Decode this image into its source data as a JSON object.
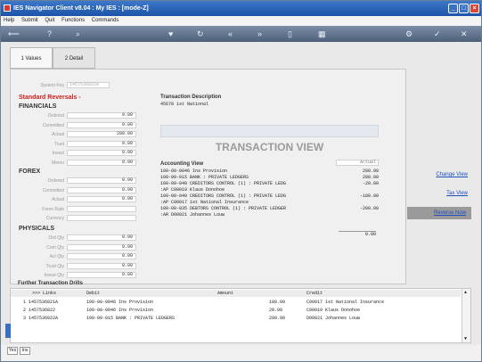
{
  "window": {
    "title": "IES Navigator Client v8.04 : My IES :     [mode-Z]"
  },
  "menu": [
    "Help",
    "Submit",
    "Quit",
    "Functions",
    "Commands"
  ],
  "tabs": [
    {
      "label": "1 Values"
    },
    {
      "label": "2 Detail"
    }
  ],
  "system_key": {
    "label": "System Key",
    "value": "1457536822A"
  },
  "standard_reversals": "Standard Reversals -",
  "financials": {
    "heading": "FINANCIALS",
    "rows": [
      {
        "label": "Ordered",
        "value": "0.00"
      },
      {
        "label": "Committed",
        "value": "0.00"
      },
      {
        "label": "Actual",
        "value": "200.00"
      },
      {
        "label": "Trust",
        "value": "0.00"
      },
      {
        "label": "Invest",
        "value": "0.00"
      },
      {
        "label": "Memo",
        "value": "0.00"
      }
    ]
  },
  "forex": {
    "heading": "FOREX",
    "rows": [
      {
        "label": "Ordered",
        "value": "0.00"
      },
      {
        "label": "Committed",
        "value": "0.00"
      },
      {
        "label": "Actual",
        "value": "0.00"
      },
      {
        "label": "Forex Rate",
        "value": ""
      },
      {
        "label": "Currency",
        "value": ""
      }
    ]
  },
  "physicals": {
    "heading": "PHYSICALS",
    "rows": [
      {
        "label": "Ord Qty",
        "value": "0.00"
      },
      {
        "label": "Com Qty",
        "value": "0.00"
      },
      {
        "label": "Act Qty",
        "value": "0.00"
      },
      {
        "label": "Trust Qty",
        "value": "0.00"
      },
      {
        "label": "Invest Qty",
        "value": "0.00"
      }
    ]
  },
  "transaction_description": {
    "label": "Transaction Description",
    "value": "45678 1st National"
  },
  "transaction_view": "TRANSACTION VIEW",
  "accounting_view": {
    "label": "Accounting View",
    "column": "Actual",
    "rows": [
      {
        "text": "100-00-0046 Ins Provision",
        "amount": "200.00"
      },
      {
        "text": "100-00-015 BANK : PRIVATE LEDGERS",
        "amount": "200.00"
      },
      {
        "text": "100-00-040 CREDITORS CONTROL (1) : PRIVATE LEDG",
        "amount": "-20.00"
      },
      {
        "text": " :AP  C00019 Klaus Donohoe",
        "amount": ""
      },
      {
        "text": "100-00-040 CREDITORS CONTROL (1) : PRIVATE LEDG",
        "amount": "-180.00"
      },
      {
        "text": " :AP  C00017 1st National Insurance",
        "amount": ""
      },
      {
        "text": "100-00-035 DEBTORS CONTROL (1) : PRIVATE LEDGER",
        "amount": "-200.00"
      },
      {
        "text": " :AR  D00021 Johannes Louw",
        "amount": ""
      }
    ],
    "total": "0.00"
  },
  "side_links": {
    "change_view": "Change View",
    "tax_view": "Tax View",
    "reverse_now": "Reverse Now"
  },
  "further_drills": {
    "heading": "Further Transaction Drills",
    "headers": {
      "links": ">>> Links",
      "debit": "Debit",
      "amount": "Amount",
      "credit": "Credit"
    },
    "rows": [
      {
        "n": "1",
        "link": "1457536821A",
        "debit": "100-00-0046 Ins Provision",
        "amount": "180.00",
        "credit": "C00017 1st National Insurance"
      },
      {
        "n": "2",
        "link": "1457536822",
        "debit": "100-00-0046 Ins Provision",
        "amount": "20.00",
        "credit": "C00019 Klaus Donohoe"
      },
      {
        "n": "3",
        "link": "1457536822A",
        "debit": "100-00-015 BANK : PRIVATE LEDGERS",
        "amount": "200.00",
        "credit": "D00021 Johannes Louw"
      }
    ]
  },
  "status_buttons": [
    "Yes",
    "Ins"
  ]
}
